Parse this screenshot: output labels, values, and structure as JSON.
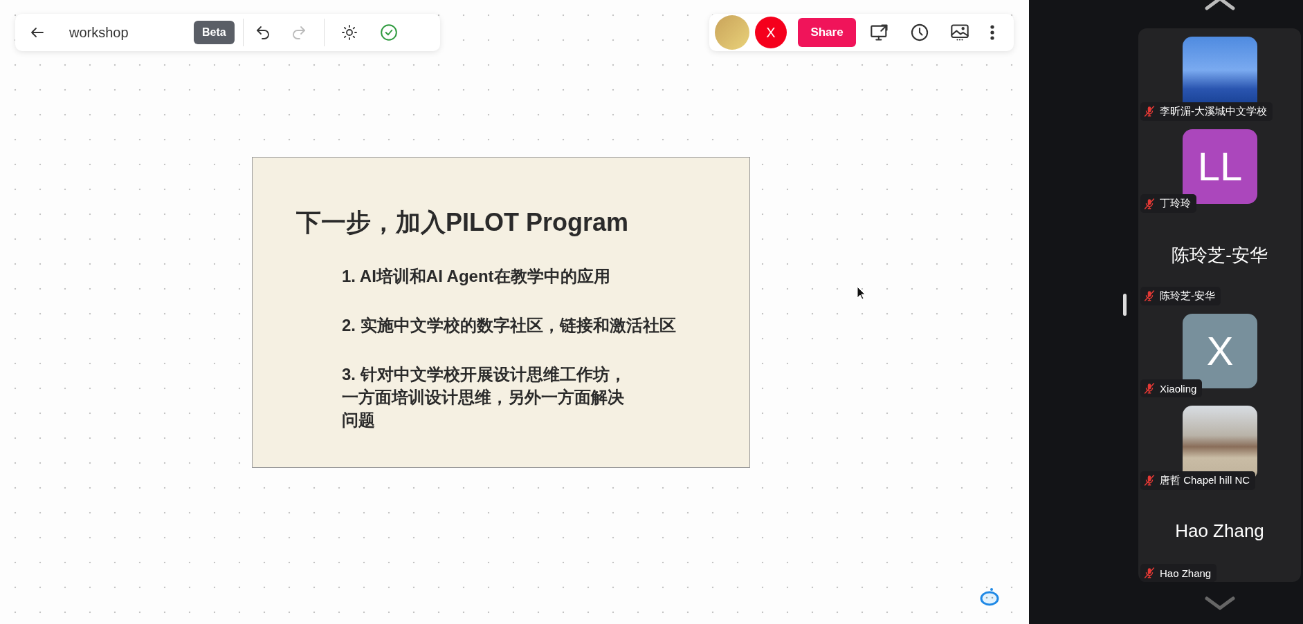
{
  "toolbar": {
    "title": "workshop",
    "badge": "Beta",
    "undo": {
      "disabled": false
    },
    "redo": {
      "disabled": true
    }
  },
  "collaborators": [
    {
      "kind": "photo"
    },
    {
      "kind": "initials",
      "initials": "X"
    }
  ],
  "share_button": "Share",
  "slide": {
    "title": "下一步，加入PILOT Program",
    "items": [
      {
        "lines": [
          "1. AI培训和AI Agent在教学中的应用"
        ]
      },
      {
        "lines": [
          "2. 实施中文学校的数字社区，链接和激活社区"
        ]
      },
      {
        "lines": [
          "3. 针对中文学校开展设计思维工作坊，",
          "一方面培训设计思维，另外一方面解决",
          "问题"
        ]
      }
    ]
  },
  "participants": [
    {
      "kind": "photo",
      "name": "李昕湄-大溪城中文学校",
      "muted": true
    },
    {
      "kind": "initials",
      "initials": "LL",
      "color": "#ab47bc",
      "name": "丁玲玲",
      "muted": true
    },
    {
      "kind": "name",
      "display_name": "陈玲芝-安华",
      "name": "陈玲芝-安华",
      "muted": true
    },
    {
      "kind": "initials",
      "initials": "X",
      "color": "#78909c",
      "name": "Xiaoling",
      "muted": true
    },
    {
      "kind": "scene",
      "name": "唐哲 Chapel hill NC",
      "muted": true
    },
    {
      "kind": "name",
      "display_name": "Hao Zhang",
      "name": "Hao Zhang",
      "muted": true
    }
  ]
}
